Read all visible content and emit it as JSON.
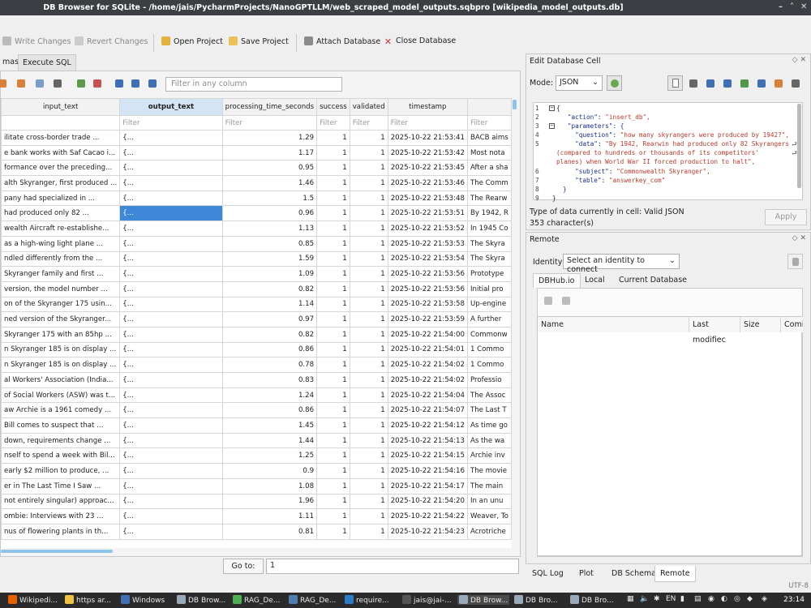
{
  "window": {
    "title": "DB Browser for SQLite - /home/jais/PycharmProjects/NanoGPTLLM/web_scraped_model_outputs.sqbpro [wikipedia_model_outputs.db]",
    "min": "–",
    "max": "˄",
    "close": "✕"
  },
  "toolbar": {
    "write_changes": "Write Changes",
    "revert_changes": "Revert Changes",
    "open_project": "Open Project",
    "save_project": "Save Project",
    "attach_database": "Attach Database",
    "close_database": "Close Database"
  },
  "tabs": {
    "schemas": "mas",
    "execute_sql": "Execute SQL"
  },
  "browse": {
    "filter_any_placeholder": "Filter in any column",
    "filter_placeholder": "Filter",
    "columns": [
      "input_text",
      "output_text",
      "processing_time_seconds",
      "success",
      "validated",
      "timestamp",
      "Filter"
    ],
    "column_filter_row": [
      "",
      "Filter",
      "Filter",
      "Filter",
      "Filter",
      "Filter",
      "Filter"
    ],
    "rows": [
      [
        "ilitate cross-border trade ...",
        "{...",
        "1.29",
        "1",
        "1",
        "2025-10-22 21:53:41",
        "BACB aims"
      ],
      [
        "e bank works with Saf Cacao i...",
        "{...",
        "1.17",
        "1",
        "1",
        "2025-10-22 21:53:42",
        "Most nota"
      ],
      [
        "formance over the preceding...",
        "{...",
        "0.95",
        "1",
        "1",
        "2025-10-22 21:53:45",
        "After a sha"
      ],
      [
        "alth Skyranger, first produced ...",
        "{...",
        "1.46",
        "1",
        "1",
        "2025-10-22 21:53:46",
        "The Comm"
      ],
      [
        "pany had specialized in ...",
        "{...",
        "1.5",
        "1",
        "1",
        "2025-10-22 21:53:48",
        "The Rearw"
      ],
      [
        "had produced only 82 ...",
        "{...",
        "0.96",
        "1",
        "1",
        "2025-10-22 21:53:51",
        "By 1942, R"
      ],
      [
        "wealth Aircraft re-establishe...",
        "{...",
        "1.13",
        "1",
        "1",
        "2025-10-22 21:53:52",
        "In 1945 Co"
      ],
      [
        "as a high-wing light plane ...",
        "{...",
        "0.85",
        "1",
        "1",
        "2025-10-22 21:53:53",
        "The Skyra"
      ],
      [
        "ndled differently from the ...",
        "{...",
        "1.59",
        "1",
        "1",
        "2025-10-22 21:53:54",
        "The Skyra"
      ],
      [
        "Skyranger family and first ...",
        "{...",
        "1.09",
        "1",
        "1",
        "2025-10-22 21:53:56",
        "Prototype"
      ],
      [
        "version, the model number ...",
        "{...",
        "0.82",
        "1",
        "1",
        "2025-10-22 21:53:56",
        "Initial pro"
      ],
      [
        "on of the Skyranger 175 usin...",
        "{...",
        "1.14",
        "1",
        "1",
        "2025-10-22 21:53:58",
        "Up-engine"
      ],
      [
        "ned version of the Skyranger...",
        "{...",
        "0.97",
        "1",
        "1",
        "2025-10-22 21:53:59",
        "A further"
      ],
      [
        "Skyranger 175 with an 85hp ...",
        "{...",
        "0.82",
        "1",
        "1",
        "2025-10-22 21:54:00",
        "Commonw"
      ],
      [
        "n Skyranger 185 is on display ...",
        "{...",
        "0.86",
        "1",
        "1",
        "2025-10-22 21:54:01",
        "1 Commo"
      ],
      [
        "n Skyranger 185 is on display ...",
        "{...",
        "0.78",
        "1",
        "1",
        "2025-10-22 21:54:02",
        "1 Commo"
      ],
      [
        "al Workers' Association (India...",
        "{...",
        "0.83",
        "1",
        "1",
        "2025-10-22 21:54:02",
        "Professio"
      ],
      [
        "of Social Workers (ASW) was t...",
        "{...",
        "1.24",
        "1",
        "1",
        "2025-10-22 21:54:04",
        "The Assoc"
      ],
      [
        "aw Archie is a 1961 comedy ...",
        "{...",
        "0.86",
        "1",
        "1",
        "2025-10-22 21:54:07",
        "The Last T"
      ],
      [
        "Bill comes to suspect that ...",
        "{...",
        "1.45",
        "1",
        "1",
        "2025-10-22 21:54:12",
        "As time go"
      ],
      [
        "down, requirements change ...",
        "{...",
        "1.44",
        "1",
        "1",
        "2025-10-22 21:54:13",
        "As the wa"
      ],
      [
        "nself to spend a week with Bil...",
        "{...",
        "1.25",
        "1",
        "1",
        "2025-10-22 21:54:15",
        "Archie inv"
      ],
      [
        "early $2 million to produce, ...",
        "{...",
        "0.9",
        "1",
        "1",
        "2025-10-22 21:54:16",
        "The movie"
      ],
      [
        "er in The Last Time I Saw ...",
        "{...",
        "1.08",
        "1",
        "1",
        "2025-10-22 21:54:17",
        "The main"
      ],
      [
        "not entirely singular) approac...",
        "{...",
        "1.96",
        "1",
        "1",
        "2025-10-22 21:54:20",
        "In an unu"
      ],
      [
        "ombie: Interviews with 23 ...",
        "{...",
        "1.11",
        "1",
        "1",
        "2025-10-22 21:54:22",
        "Weaver, To"
      ],
      [
        "nus of flowering plants in th...",
        "{...",
        "0.81",
        "1",
        "1",
        "2025-10-22 21:54:23",
        "Acrotriche"
      ]
    ],
    "goto_label": "Go to:",
    "goto_value": "1"
  },
  "edit_cell": {
    "title": "Edit Database Cell",
    "mode_label": "Mode:",
    "mode_value": "JSON",
    "line_numbers": [
      "1",
      "2",
      "3",
      "4",
      "5",
      "6",
      "7",
      "8",
      "9"
    ],
    "code": {
      "l1": "{",
      "l2k": "\"action\"",
      "l2v": "\"insert_db\",",
      "l3k": "\"parameters\"",
      "l3v": ": {",
      "l4k": "\"question\"",
      "l4v": "\"how many skyrangers were produced by 1942?\",",
      "l5k": "\"data\"",
      "l5v": "\"By 1942, Rearwin had produced only 82 Skyrangers",
      "l5b": "(compared to hundreds or thousands of its competitors'",
      "l5c": "planes) when World War II forced production to halt\",",
      "l6k": "\"subject\"",
      "l6v": "\"Commonwealth Skyranger\",",
      "l7k": "\"table\"",
      "l7v": "\"answerkey_com\"",
      "l8": "}",
      "l9": "}"
    },
    "type_text": "Type of data currently in cell: Valid JSON",
    "char_count": "353 character(s)",
    "apply_label": "Apply"
  },
  "remote": {
    "title": "Remote",
    "identity_label": "Identity",
    "identity_value": "Select an identity to connect",
    "tabs": [
      "DBHub.io",
      "Local",
      "Current Database"
    ],
    "columns": [
      "Name",
      "Last modifiec",
      "Size",
      "Comi"
    ]
  },
  "bottom_tabs": [
    "SQL Log",
    "Plot",
    "DB Schema",
    "Remote"
  ],
  "status": {
    "encoding": "UTF-8"
  },
  "taskbar": {
    "items": [
      "Wikipedi...",
      "https ar...",
      "Windows",
      "DB Brow...",
      "RAG_De...",
      "RAG_De...",
      "require...",
      "jais@jai-...",
      "DB Brow...",
      "DB Bro...",
      "DB Bro..."
    ],
    "lang": "EN",
    "clock": "23:14"
  },
  "colors": {
    "accent": "#3e88d8",
    "titlebar": "#3b3f44",
    "taskbar": "#2b2b2b",
    "json_key": "#1a2e8c",
    "json_string": "#c0392b"
  }
}
